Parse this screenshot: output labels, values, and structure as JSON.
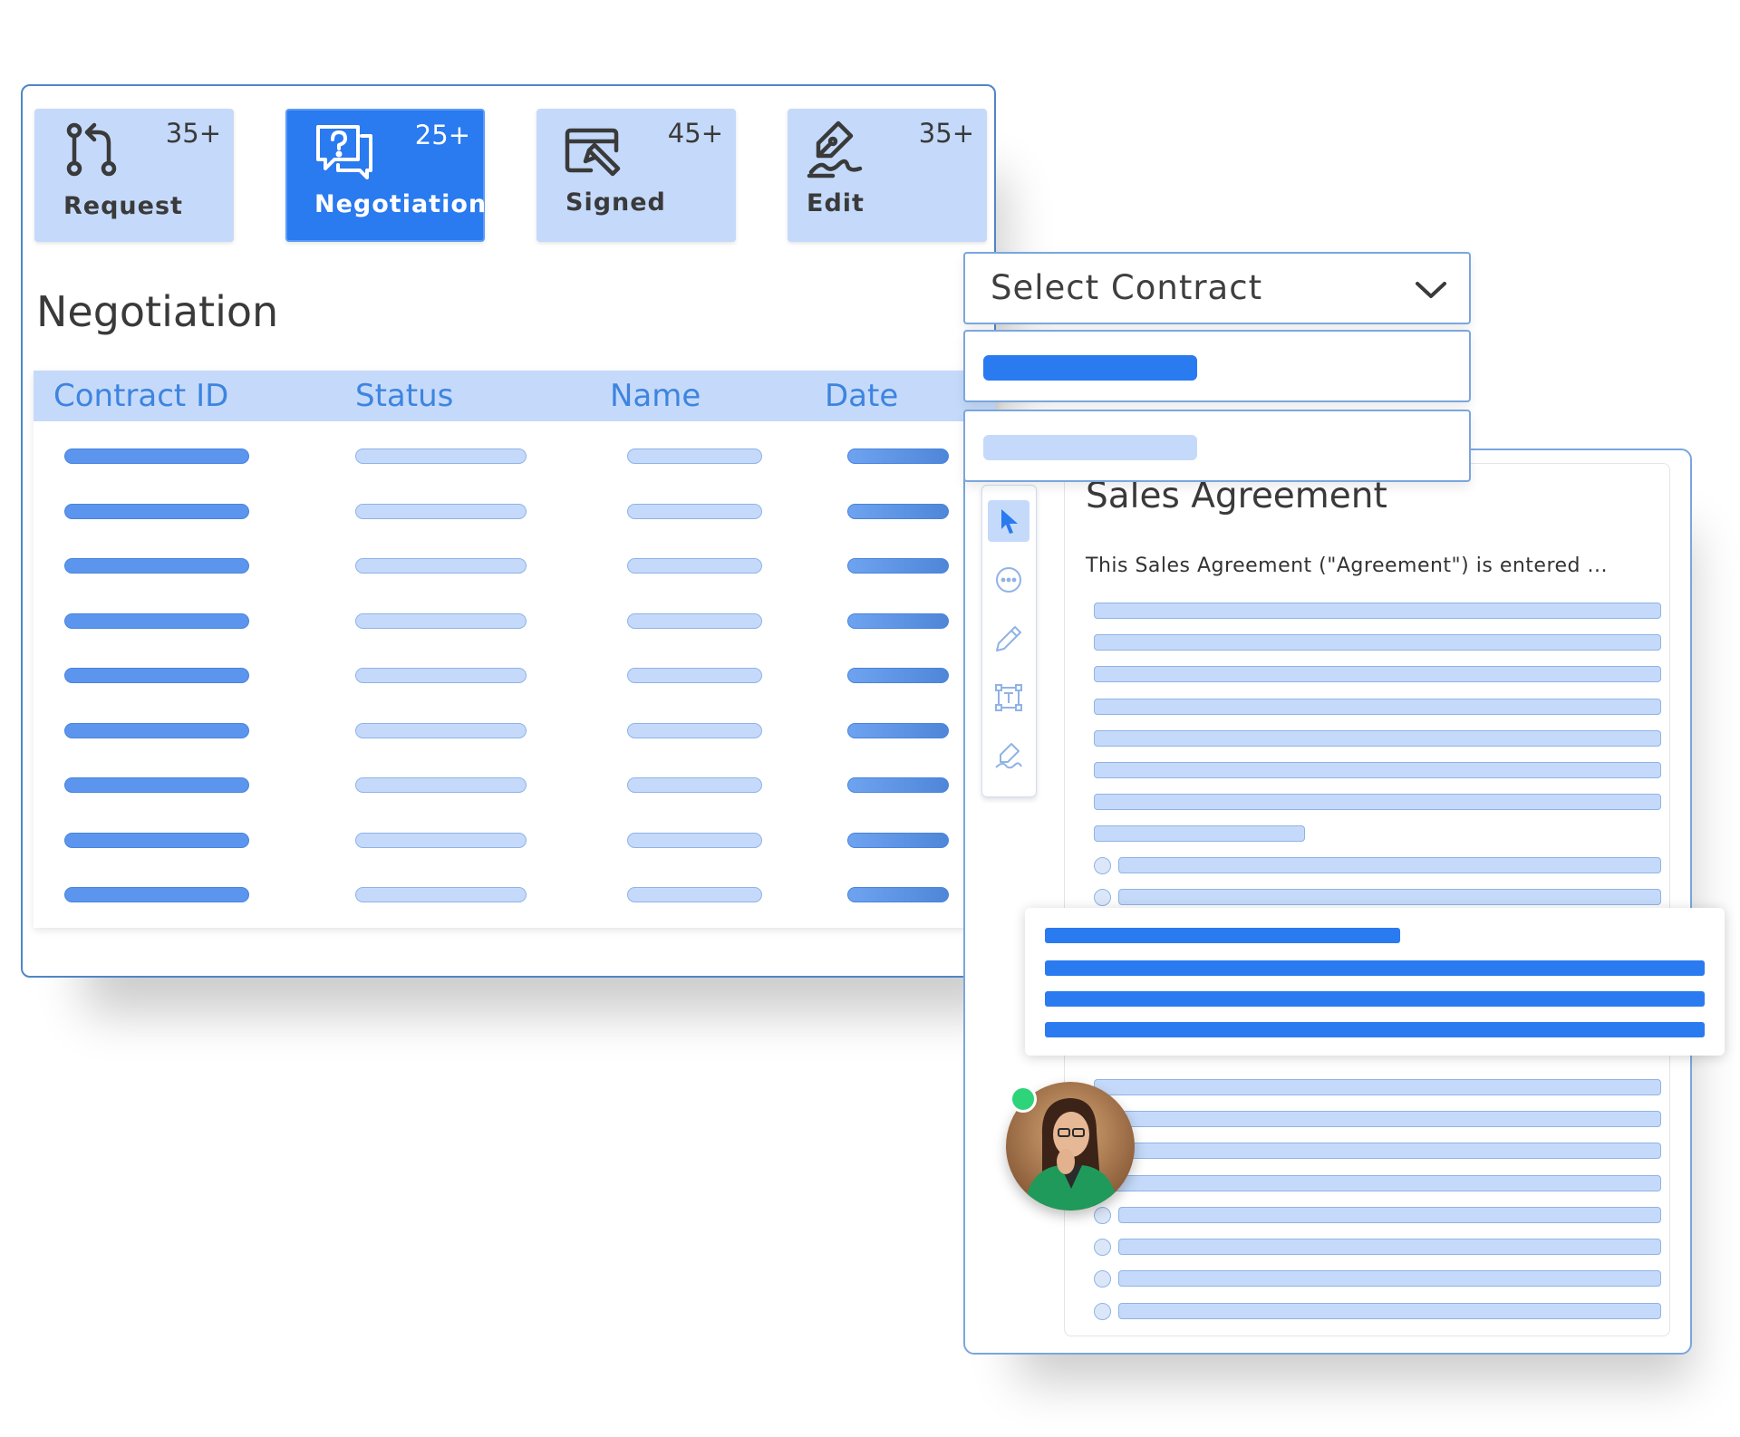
{
  "tabs": [
    {
      "label": "Request",
      "count": "35+",
      "icon": "git-branch-icon"
    },
    {
      "label": "Negotiation",
      "count": "25+",
      "icon": "question-chat-icon",
      "active": true
    },
    {
      "label": "Signed",
      "count": "45+",
      "icon": "signed-window-icon"
    },
    {
      "label": "Edit",
      "count": "35+",
      "icon": "pen-signature-icon"
    }
  ],
  "section_title": "Negotiation",
  "table": {
    "columns": [
      "Contract ID",
      "Status",
      "Name",
      "Date"
    ],
    "row_count": 9
  },
  "select_contract": {
    "label": "Select Contract",
    "icon": "chevron-down-icon"
  },
  "document": {
    "title": "Sales Agreement",
    "intro": "This Sales Agreement (\"Agreement\") is entered ...",
    "tools": [
      "cursor-icon",
      "comment-icon",
      "pen-icon",
      "text-box-icon",
      "signature-icon"
    ]
  },
  "colors": {
    "accent": "#2a7af0",
    "light_accent": "#c5dafa",
    "header_text": "#3e84e0",
    "online": "#2ed47a"
  }
}
